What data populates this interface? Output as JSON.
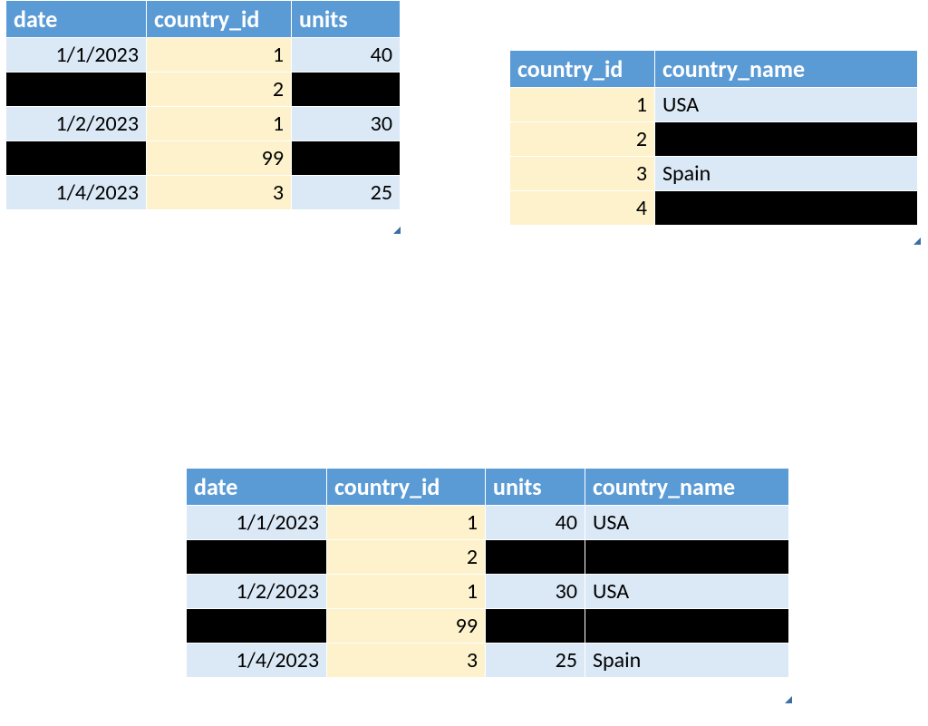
{
  "table1": {
    "headers": [
      "date",
      "country_id",
      "units"
    ],
    "rows": [
      {
        "date": "1/1/2023",
        "country_id": "1",
        "units": "40"
      },
      {
        "date": "",
        "country_id": "2",
        "units": ""
      },
      {
        "date": "1/2/2023",
        "country_id": "1",
        "units": "30"
      },
      {
        "date": "",
        "country_id": "99",
        "units": ""
      },
      {
        "date": "1/4/2023",
        "country_id": "3",
        "units": "25"
      }
    ]
  },
  "table2": {
    "headers": [
      "country_id",
      "country_name"
    ],
    "rows": [
      {
        "country_id": "1",
        "country_name": "USA"
      },
      {
        "country_id": "2",
        "country_name": ""
      },
      {
        "country_id": "3",
        "country_name": "Spain"
      },
      {
        "country_id": "4",
        "country_name": ""
      }
    ]
  },
  "table3": {
    "headers": [
      "date",
      "country_id",
      "units",
      "country_name"
    ],
    "rows": [
      {
        "date": "1/1/2023",
        "country_id": "1",
        "units": "40",
        "country_name": "USA"
      },
      {
        "date": "",
        "country_id": "2",
        "units": "",
        "country_name": ""
      },
      {
        "date": "1/2/2023",
        "country_id": "1",
        "units": "30",
        "country_name": "USA"
      },
      {
        "date": "",
        "country_id": "99",
        "units": "",
        "country_name": ""
      },
      {
        "date": "1/4/2023",
        "country_id": "3",
        "units": "25",
        "country_name": "Spain"
      }
    ]
  }
}
